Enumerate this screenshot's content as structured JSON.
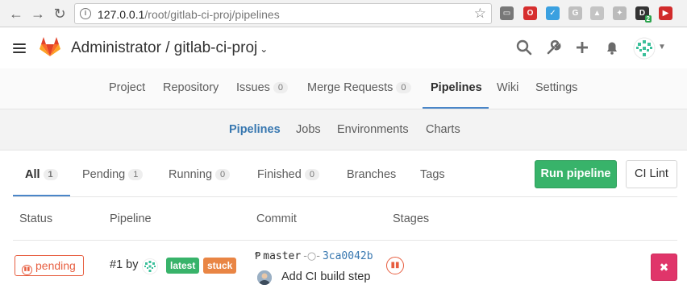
{
  "browser": {
    "url_host": "127.0.0.1",
    "url_path": "/root/gitlab-ci-proj/pipelines",
    "extensions": [
      {
        "name": "cast-icon",
        "color": "#777777",
        "glyph": "▭"
      },
      {
        "name": "opera-icon",
        "color": "#d62e2e",
        "glyph": "O"
      },
      {
        "name": "pocket-icon",
        "color": "#3aa0e0",
        "glyph": "✓"
      },
      {
        "name": "google-ext-icon",
        "color": "#bfbfbf",
        "glyph": "G"
      },
      {
        "name": "drive-icon",
        "color": "#c4c4c4",
        "glyph": "▲"
      },
      {
        "name": "puzzle-icon",
        "color": "#bbbbbb",
        "glyph": "✦"
      },
      {
        "name": "badge-ext-icon",
        "color": "#333333",
        "glyph": "D",
        "count": "2"
      },
      {
        "name": "record-ext-icon",
        "color": "#d12b2b",
        "glyph": "▶"
      }
    ]
  },
  "header": {
    "title": "Administrator / gitlab-ci-proj",
    "icons": [
      "search-icon",
      "wrench-icon",
      "plus-icon",
      "bell-icon"
    ]
  },
  "project_nav": {
    "items": [
      {
        "label": "Project"
      },
      {
        "label": "Repository"
      },
      {
        "label": "Issues",
        "count": "0"
      },
      {
        "label": "Merge Requests",
        "count": "0"
      },
      {
        "label": "Pipelines",
        "active": true
      },
      {
        "label": "Wiki"
      },
      {
        "label": "Settings"
      }
    ]
  },
  "sub_nav": {
    "items": [
      {
        "label": "Pipelines",
        "active": true
      },
      {
        "label": "Jobs"
      },
      {
        "label": "Environments"
      },
      {
        "label": "Charts"
      }
    ]
  },
  "tabs": {
    "items": [
      {
        "label": "All",
        "count": "1",
        "active": true
      },
      {
        "label": "Pending",
        "count": "1"
      },
      {
        "label": "Running",
        "count": "0"
      },
      {
        "label": "Finished",
        "count": "0"
      },
      {
        "label": "Branches"
      },
      {
        "label": "Tags"
      }
    ],
    "run_pipeline_label": "Run pipeline",
    "ci_lint_label": "CI Lint"
  },
  "table": {
    "columns": [
      "Status",
      "Pipeline",
      "Commit",
      "Stages"
    ],
    "rows": [
      {
        "status": "pending",
        "pipeline_id": "#1 by",
        "labels": [
          "latest",
          "stuck"
        ],
        "branch": "master",
        "sha": "3ca0042b",
        "commit_title": "Add CI build step",
        "stage_status": "pending",
        "cancel_glyph": "✖"
      }
    ]
  },
  "colors": {
    "accent": "#4a86c8",
    "link": "#3777b0",
    "success": "#38b36a",
    "pending": "#e75e40",
    "stuck": "#e98544",
    "danger": "#e0356a"
  }
}
